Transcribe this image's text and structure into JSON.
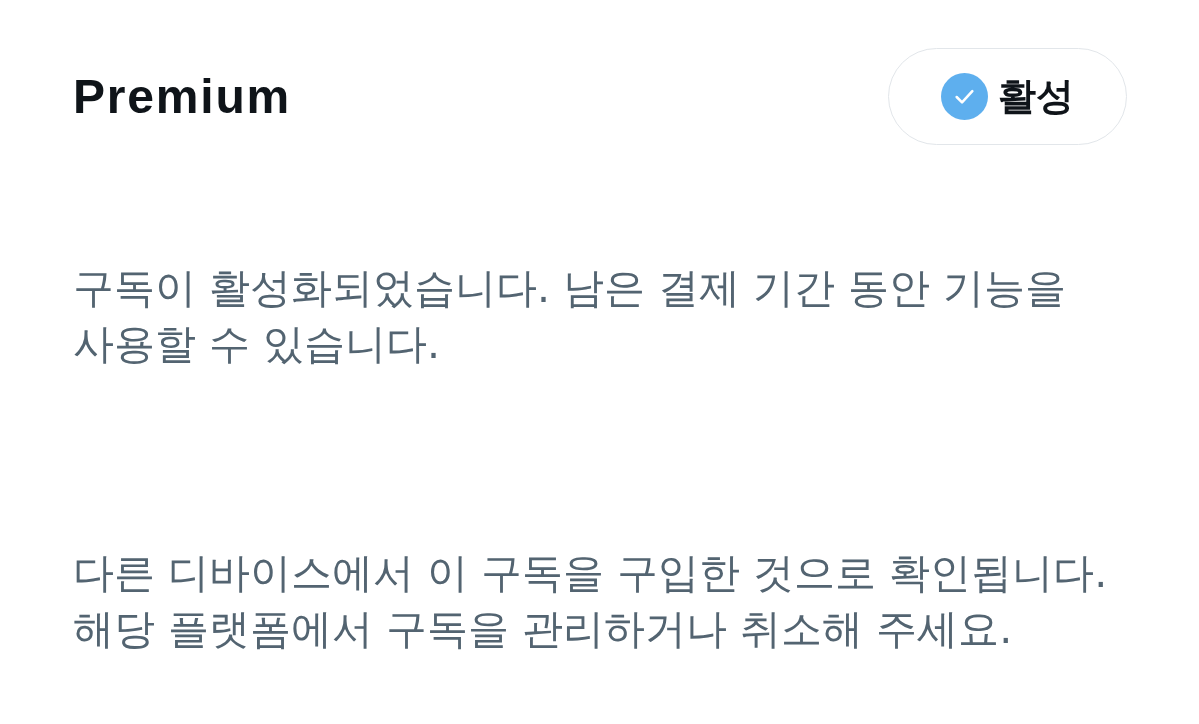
{
  "header": {
    "title": "Premium",
    "status": {
      "label": "활성",
      "active": true
    }
  },
  "messages": [
    "구독이 활성화되었습니다. 남은 결제 기간 동안 기능을 사용할 수 있습니다.",
    "다른 디바이스에서 이 구독을 구입한 것으로 확인됩니다. 해당 플랫폼에서 구독을 관리하거나 취소해 주세요."
  ]
}
